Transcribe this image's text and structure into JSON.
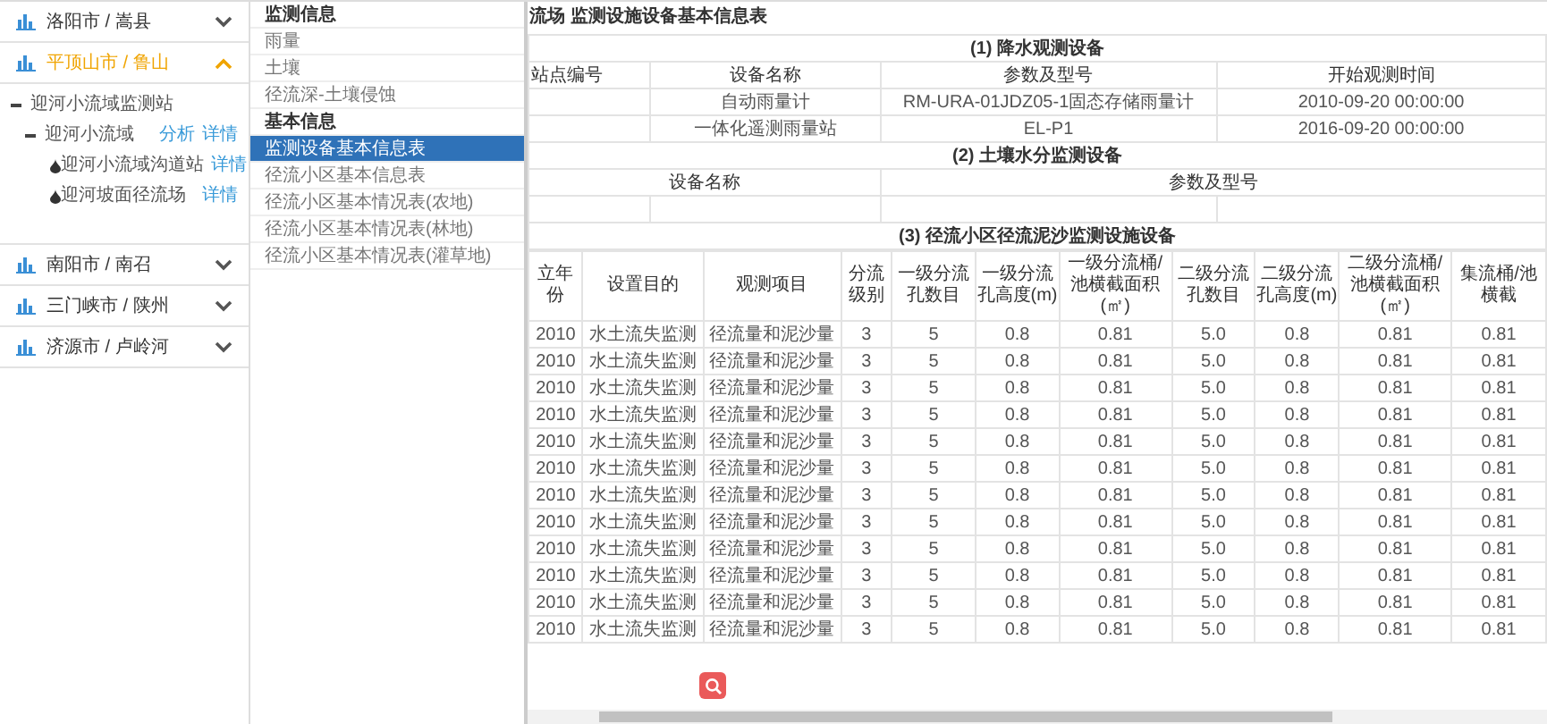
{
  "regions": [
    {
      "label": "洛阳市 / 嵩县",
      "expanded": false
    },
    {
      "label": "平顶山市 / 鲁山",
      "expanded": true,
      "tree": [
        {
          "label": "迎河小流域监测站",
          "expanded": true,
          "children": [
            {
              "label": "迎河小流域",
              "expanded": true,
              "links": [
                "分析",
                "详情"
              ],
              "children": [
                {
                  "label": "迎河小流域沟道站",
                  "links": [
                    "详情"
                  ]
                },
                {
                  "label": "迎河坡面径流场",
                  "links": [
                    "详情"
                  ]
                }
              ]
            }
          ]
        }
      ]
    },
    {
      "label": "南阳市 / 南召",
      "expanded": false
    },
    {
      "label": "三门峡市 / 陕州",
      "expanded": false
    },
    {
      "label": "济源市 / 卢岭河",
      "expanded": false
    }
  ],
  "menu": [
    {
      "kind": "header",
      "label": "监测信息"
    },
    {
      "kind": "item",
      "label": "雨量",
      "selected": false
    },
    {
      "kind": "item",
      "label": "土壤",
      "selected": false
    },
    {
      "kind": "item",
      "label": "径流深-土壤侵蚀",
      "selected": false
    },
    {
      "kind": "header",
      "label": "基本信息"
    },
    {
      "kind": "item",
      "label": "监测设备基本信息表",
      "selected": true
    },
    {
      "kind": "item",
      "label": "径流小区基本信息表",
      "selected": false
    },
    {
      "kind": "item",
      "label": "径流小区基本情况表(农地)",
      "selected": false
    },
    {
      "kind": "item",
      "label": "径流小区基本情况表(林地)",
      "selected": false
    },
    {
      "kind": "item",
      "label": "径流小区基本情况表(灌草地)",
      "selected": false
    }
  ],
  "title": "流场 监测设施设备基本信息表",
  "rain": {
    "caption": "(1) 降水观测设备",
    "columns": [
      "站点编号",
      "设备名称",
      "参数及型号",
      "开始观测时间"
    ],
    "rows": [
      [
        "",
        "自动雨量计",
        "RM-URA-01JDZ05-1固态存储雨量计",
        "2010-09-20 00:00:00"
      ],
      [
        "",
        "一体化遥测雨量站",
        "EL-P1",
        "2016-09-20 00:00:00"
      ]
    ]
  },
  "soil": {
    "caption": "(2) 土壤水分监测设备",
    "columns": [
      "设备名称",
      "参数及型号"
    ]
  },
  "runoff": {
    "caption": "(3) 径流小区径流泥沙监测设施设备",
    "columns": [
      "立年份",
      "设置目的",
      "观测项目",
      "分流级别",
      "一级分流孔数目",
      "一级分流孔高度(m)",
      "一级分流桶/池横截面积(㎡)",
      "二级分流孔数目",
      "二级分流孔高度(m)",
      "二级分流桶/池横截面积(㎡)",
      "集流桶/池横截"
    ],
    "rows": [
      [
        "2010",
        "水土流失监测",
        "径流量和泥沙量",
        "3",
        "5",
        "0.8",
        "0.81",
        "5.0",
        "0.8",
        "0.81",
        "0.81"
      ],
      [
        "2010",
        "水土流失监测",
        "径流量和泥沙量",
        "3",
        "5",
        "0.8",
        "0.81",
        "5.0",
        "0.8",
        "0.81",
        "0.81"
      ],
      [
        "2010",
        "水土流失监测",
        "径流量和泥沙量",
        "3",
        "5",
        "0.8",
        "0.81",
        "5.0",
        "0.8",
        "0.81",
        "0.81"
      ],
      [
        "2010",
        "水土流失监测",
        "径流量和泥沙量",
        "3",
        "5",
        "0.8",
        "0.81",
        "5.0",
        "0.8",
        "0.81",
        "0.81"
      ],
      [
        "2010",
        "水土流失监测",
        "径流量和泥沙量",
        "3",
        "5",
        "0.8",
        "0.81",
        "5.0",
        "0.8",
        "0.81",
        "0.81"
      ],
      [
        "2010",
        "水土流失监测",
        "径流量和泥沙量",
        "3",
        "5",
        "0.8",
        "0.81",
        "5.0",
        "0.8",
        "0.81",
        "0.81"
      ],
      [
        "2010",
        "水土流失监测",
        "径流量和泥沙量",
        "3",
        "5",
        "0.8",
        "0.81",
        "5.0",
        "0.8",
        "0.81",
        "0.81"
      ],
      [
        "2010",
        "水土流失监测",
        "径流量和泥沙量",
        "3",
        "5",
        "0.8",
        "0.81",
        "5.0",
        "0.8",
        "0.81",
        "0.81"
      ],
      [
        "2010",
        "水土流失监测",
        "径流量和泥沙量",
        "3",
        "5",
        "0.8",
        "0.81",
        "5.0",
        "0.8",
        "0.81",
        "0.81"
      ],
      [
        "2010",
        "水土流失监测",
        "径流量和泥沙量",
        "3",
        "5",
        "0.8",
        "0.81",
        "5.0",
        "0.8",
        "0.81",
        "0.81"
      ],
      [
        "2010",
        "水土流失监测",
        "径流量和泥沙量",
        "3",
        "5",
        "0.8",
        "0.81",
        "5.0",
        "0.8",
        "0.81",
        "0.81"
      ],
      [
        "2010",
        "水土流失监测",
        "径流量和泥沙量",
        "3",
        "5",
        "0.8",
        "0.81",
        "5.0",
        "0.8",
        "0.81",
        "0.81"
      ]
    ]
  }
}
